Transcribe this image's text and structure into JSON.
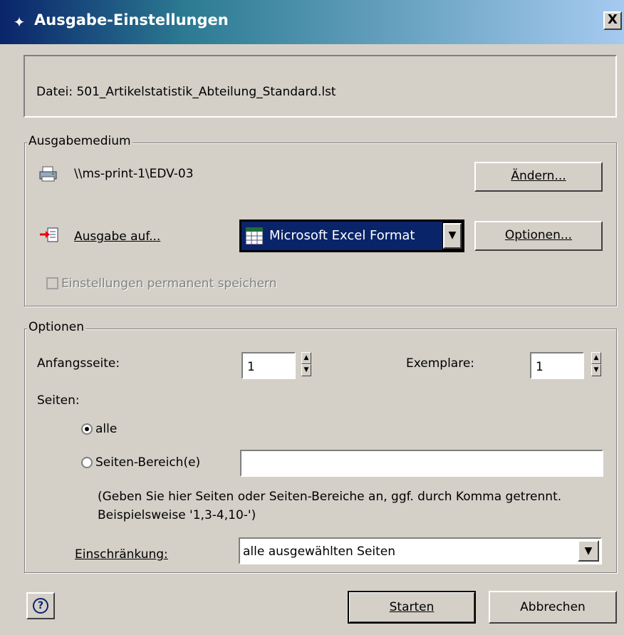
{
  "window": {
    "title": "Ausgabe-Einstellungen",
    "close_label": "X"
  },
  "file": {
    "label": "Datei: 501_Artikelstatistik_Abteilung_Standard.lst"
  },
  "output_medium": {
    "legend": "Ausgabemedium",
    "printer": "\\\\ms-print-1\\EDV-03",
    "change_button": "Ändern...",
    "output_to_label": "Ausgabe auf...",
    "format_selected": "Microsoft Excel Format",
    "options_button": "Optionen...",
    "save_permanent_label": "Einstellungen permanent speichern",
    "save_permanent_checked": false
  },
  "options": {
    "legend": "Optionen",
    "start_page_label": "Anfangsseite:",
    "start_page_value": "1",
    "copies_label": "Exemplare:",
    "copies_value": "1",
    "pages_label": "Seiten:",
    "radio_all": "alle",
    "radio_range": "Seiten-Bereich(e)",
    "selected_radio": "all",
    "range_value": "",
    "hint": "(Geben Sie hier Seiten oder Seiten-Bereiche an, ggf. durch Komma getrennt. Beispielsweise '1,3-4,10-')",
    "restriction_label": "Einschränkung:",
    "restriction_value": "alle ausgewählten Seiten"
  },
  "footer": {
    "help_label": "?",
    "start_button": "Starten",
    "cancel_button": "Abbrechen"
  },
  "icons": [
    "settings-icon",
    "printer-icon",
    "export-arrow-icon",
    "excel-icon",
    "dropdown-arrow-icon",
    "spin-up-icon",
    "spin-down-icon",
    "help-icon"
  ]
}
